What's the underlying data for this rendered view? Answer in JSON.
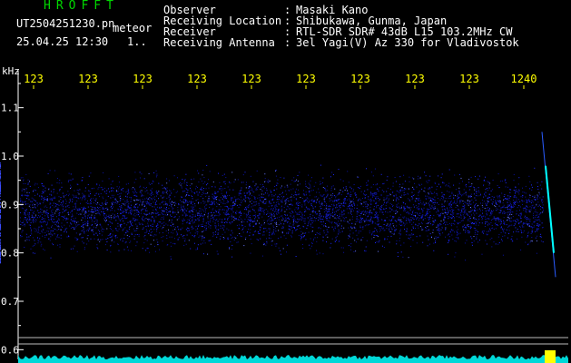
{
  "header": {
    "logo": "HROFFT",
    "filename": "UT2504251230.pn",
    "kind": "meteor",
    "datetime": "25.04.25 12:30",
    "count": "1.."
  },
  "meta": [
    {
      "label": "Observer",
      "value": "Masaki Kano"
    },
    {
      "label": "Receiving Location",
      "value": "Shibukawa, Gunma, Japan"
    },
    {
      "label": "Receiver",
      "value": "RTL-SDR SDR# 43dB L15 103.2MHz CW"
    },
    {
      "label": "Receiving Antenna",
      "value": "3el Yagi(V) Az 330 for Vladivostok"
    }
  ],
  "chart_data": {
    "type": "heatmap",
    "ylabel": "kHz",
    "x_ticks": [
      "123",
      "123",
      "123",
      "123",
      "123",
      "123",
      "123",
      "123",
      "123",
      "1240"
    ],
    "y_ticks": [
      1.1,
      1.0,
      0.9,
      0.8,
      0.7,
      0.6
    ],
    "ylim": [
      0.58,
      1.15
    ],
    "noise_band": [
      0.78,
      0.99
    ],
    "meteor_echo": {
      "freq_start": 1.05,
      "freq_end": 0.75
    },
    "colors": {
      "axis": "#ffffff",
      "noise": "#1e28ff",
      "echo": "#00ffff",
      "baseline": "#00d8d8",
      "peak": "#ffff00"
    }
  }
}
